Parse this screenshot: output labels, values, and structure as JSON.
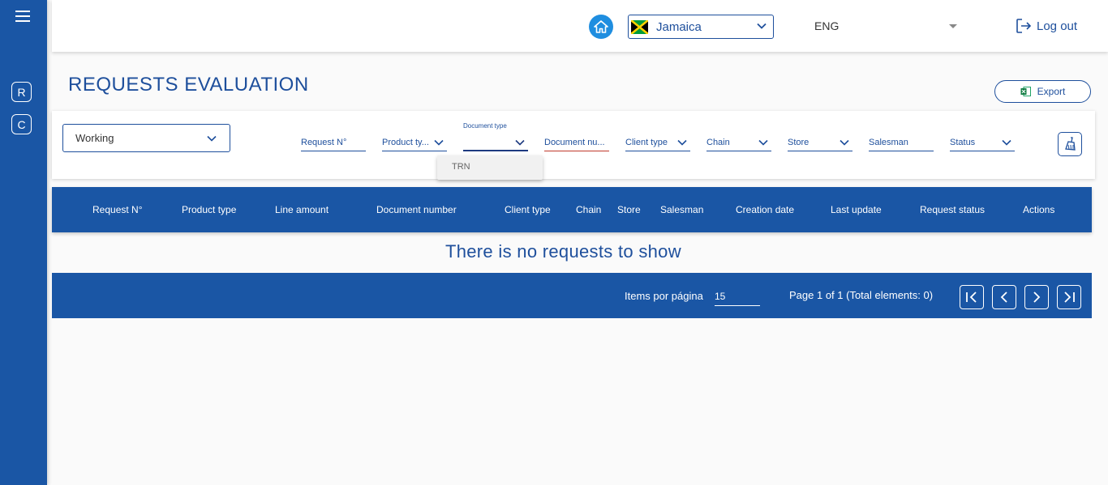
{
  "sidebar": {
    "menu_icon": "hamburger-icon",
    "shortcuts": [
      {
        "label": "R"
      },
      {
        "label": "C"
      }
    ]
  },
  "header": {
    "home_icon": "home-icon",
    "country": {
      "label": "Jamaica",
      "flag": "jamaica-flag-icon"
    },
    "language": "ENG",
    "logout_label": "Log out"
  },
  "page": {
    "title": "REQUESTS EVALUATION",
    "export_label": "Export"
  },
  "filters": {
    "scope_select": "Working",
    "fields": [
      {
        "label": "Request N°"
      },
      {
        "label": "Product ty..."
      },
      {
        "label": "Document type"
      },
      {
        "label": "Document nu..."
      },
      {
        "label": "Client type"
      },
      {
        "label": "Chain"
      },
      {
        "label": "Store"
      },
      {
        "label": "Salesman"
      },
      {
        "label": "Status"
      }
    ],
    "document_type_options": [
      "TRN"
    ]
  },
  "table": {
    "columns": [
      "Request N°",
      "Product type",
      "Line amount",
      "Document number",
      "Client type",
      "Chain",
      "Store",
      "Salesman",
      "Creation date",
      "Last update",
      "Request status",
      "Actions"
    ],
    "empty_message": "There is no requests to show"
  },
  "pagination": {
    "items_label": "Items por página",
    "items_per_page": "15",
    "page_info": "Page 1 of 1 (Total elements: 0)"
  },
  "colors": {
    "primary": "#1a56a5",
    "accent": "#1f8ee0",
    "text": "#1e4f9c"
  }
}
